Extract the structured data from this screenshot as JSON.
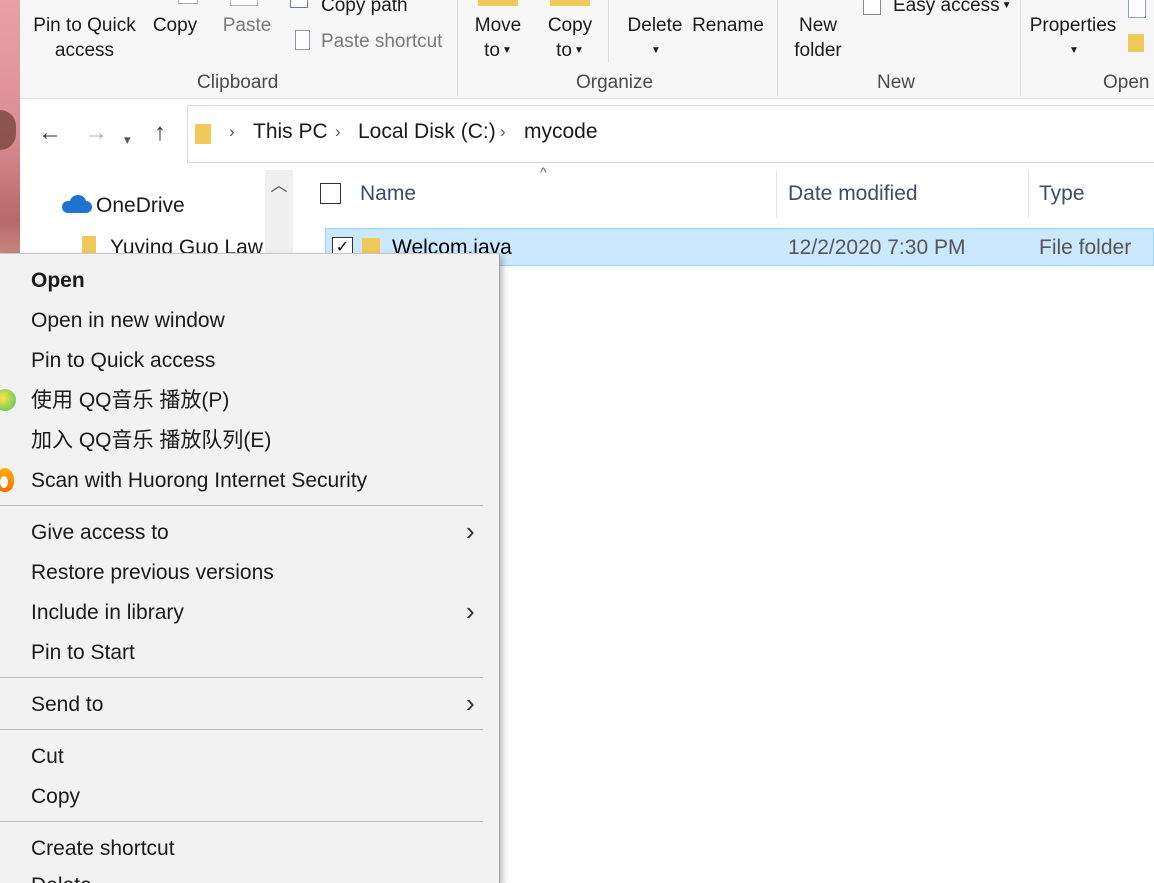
{
  "ribbon": {
    "clipboard": {
      "pin_label_1": "Pin to Quick",
      "pin_label_2": "access",
      "copy_label": "Copy",
      "paste_label": "Paste",
      "copy_path_label": "Copy path",
      "paste_shortcut_label": "Paste shortcut",
      "group_label": "Clipboard"
    },
    "organize": {
      "move_to_1": "Move",
      "move_to_2": "to",
      "copy_to_1": "Copy",
      "copy_to_2": "to",
      "delete_label": "Delete",
      "rename_label": "Rename",
      "group_label": "Organize"
    },
    "new": {
      "new_folder_1": "New",
      "new_folder_2": "folder",
      "easy_access_label": "Easy access",
      "group_label": "New"
    },
    "open": {
      "properties_label": "Properties",
      "group_label": "Open"
    }
  },
  "address": {
    "crumbs": [
      "This PC",
      "Local Disk (C:)",
      "mycode"
    ]
  },
  "sidebar": {
    "items": [
      "OneDrive",
      "Yuying Guo Law"
    ]
  },
  "filelist": {
    "columns": [
      "Name",
      "Date modified",
      "Type"
    ],
    "rows": [
      {
        "name": "Welcom.java",
        "date": "12/2/2020 7:30 PM",
        "type": "File folder",
        "selected": true
      }
    ]
  },
  "context_menu": {
    "items": [
      "Open",
      "Open in new window",
      "Pin to Quick access",
      "使用 QQ音乐 播放(P)",
      "加入 QQ音乐 播放队列(E)",
      "Scan with Huorong Internet Security",
      "Give access to",
      "Restore previous versions",
      "Include in library",
      "Pin to Start",
      "Send to",
      "Cut",
      "Copy",
      "Create shortcut",
      "Delete"
    ]
  },
  "colors": {
    "selection_bg": "#cce8ff",
    "selection_border": "#99d1ff",
    "folder_yellow": "#f1c95a",
    "header_text": "#3c4d66",
    "menu_bg": "#f2f2f2"
  }
}
